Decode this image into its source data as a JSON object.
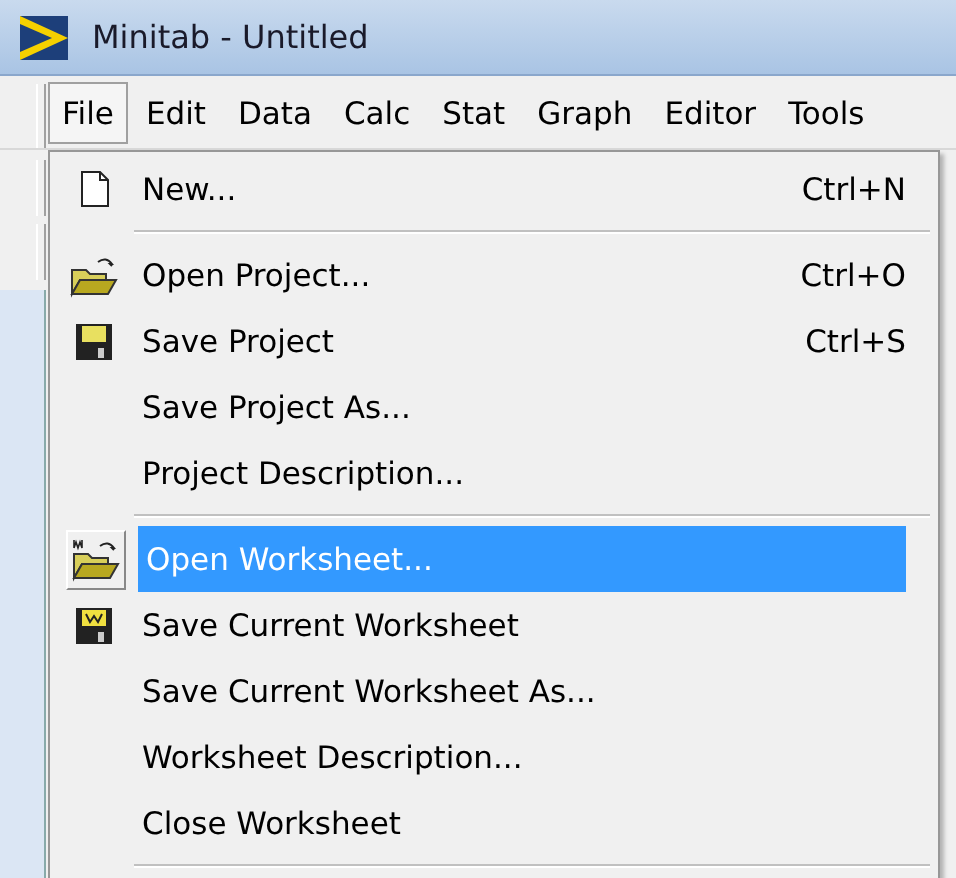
{
  "window": {
    "title": "Minitab - Untitled"
  },
  "menu_bar": [
    {
      "label": "File",
      "selected": true
    },
    {
      "label": "Edit",
      "selected": false
    },
    {
      "label": "Data",
      "selected": false
    },
    {
      "label": "Calc",
      "selected": false
    },
    {
      "label": "Stat",
      "selected": false
    },
    {
      "label": "Graph",
      "selected": false
    },
    {
      "label": "Editor",
      "selected": false
    },
    {
      "label": "Tools",
      "selected": false
    }
  ],
  "file_menu": [
    {
      "kind": "item",
      "label": "New...",
      "shortcut": "Ctrl+N",
      "selected": false
    },
    {
      "kind": "separator"
    },
    {
      "kind": "item",
      "label": "Open Project...",
      "shortcut": "Ctrl+O",
      "selected": false
    },
    {
      "kind": "item",
      "label": "Save Project",
      "shortcut": "Ctrl+S",
      "selected": false
    },
    {
      "kind": "item",
      "label": "Save Project As...",
      "selected": false
    },
    {
      "kind": "item",
      "label": "Project Description...",
      "selected": false
    },
    {
      "kind": "separator"
    },
    {
      "kind": "item",
      "label": "Open Worksheet...",
      "selected": true
    },
    {
      "kind": "item",
      "label": "Save Current Worksheet",
      "selected": false
    },
    {
      "kind": "item",
      "label": "Save Current Worksheet As...",
      "selected": false
    },
    {
      "kind": "item",
      "label": "Worksheet Description...",
      "selected": false
    },
    {
      "kind": "item",
      "label": "Close Worksheet",
      "selected": false
    },
    {
      "kind": "separator"
    }
  ]
}
